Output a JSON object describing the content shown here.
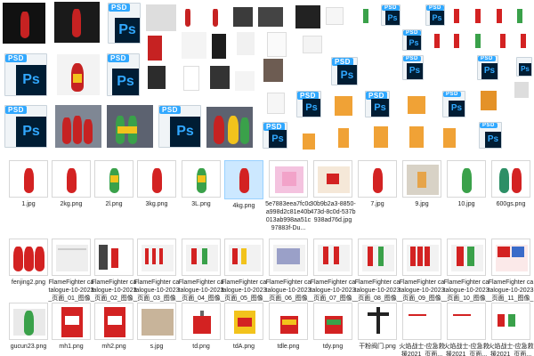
{
  "row1_labels": [
    "1.jpg",
    "2kg.png",
    "2l.png",
    "3kg.png",
    "3L.png",
    "4kg.png",
    "5e7883eea7fc0ca998d2c81e40b013ab998aa51c97883f-Du...",
    "30b9b2a3-8850-473d-8c0d-537b938ad76d.jpg",
    "7.jpg",
    "9.jpg",
    "10.jpg",
    "600gs.png"
  ],
  "row2_labels": [
    "fenjing2.png",
    "FlameFighter catalogue-10-2023_页面_01_图像_0001.jpg",
    "FlameFighter catalogue-10-2023_页面_02_图像_0001.jpg",
    "FlameFighter catalogue-10-2023_页面_03_图像_0001.jpg",
    "FlameFighter catalogue-10-2023_页面_04_图像_0001.jpg",
    "FlameFighter catalogue-10-2023_页面_05_图像_0001.jpg",
    "FlameFighter catalogue-10-2023_页面_06_图像_0001.jpg",
    "FlameFighter catalogue-10-2023_页面_07_图像_0001.jpg",
    "FlameFighter catalogue-10-2023_页面_08_图像_0001.jpg",
    "FlameFighter catalogue-10-2023_页面_09_图像_0001.jpg",
    "FlameFighter catalogue-10-2023_页面_10_图像_0001.jpg",
    "FlameFighter catalogue-10-2023_页面_11_图像_0001.jpg"
  ],
  "row3_labels": [
    "gucun23.png",
    "mh1.png",
    "mh2.png",
    "s.jpg",
    "td.png",
    "tdA.png",
    "tdle.png",
    "tdy.png",
    "干粉阀门.png",
    "火焰战士-应急救援2021_页面...",
    "火焰战士-应急救援2021_页面...",
    "火焰战士-应急救援2021_页面..."
  ],
  "psd_badge": "PSD",
  "ps_mark": "Ps",
  "colors": {
    "psd_blue": "#31a8ff",
    "ps_dark": "#001d34",
    "extinguisher_red": "#d32222",
    "selection": "#cce8ff"
  }
}
